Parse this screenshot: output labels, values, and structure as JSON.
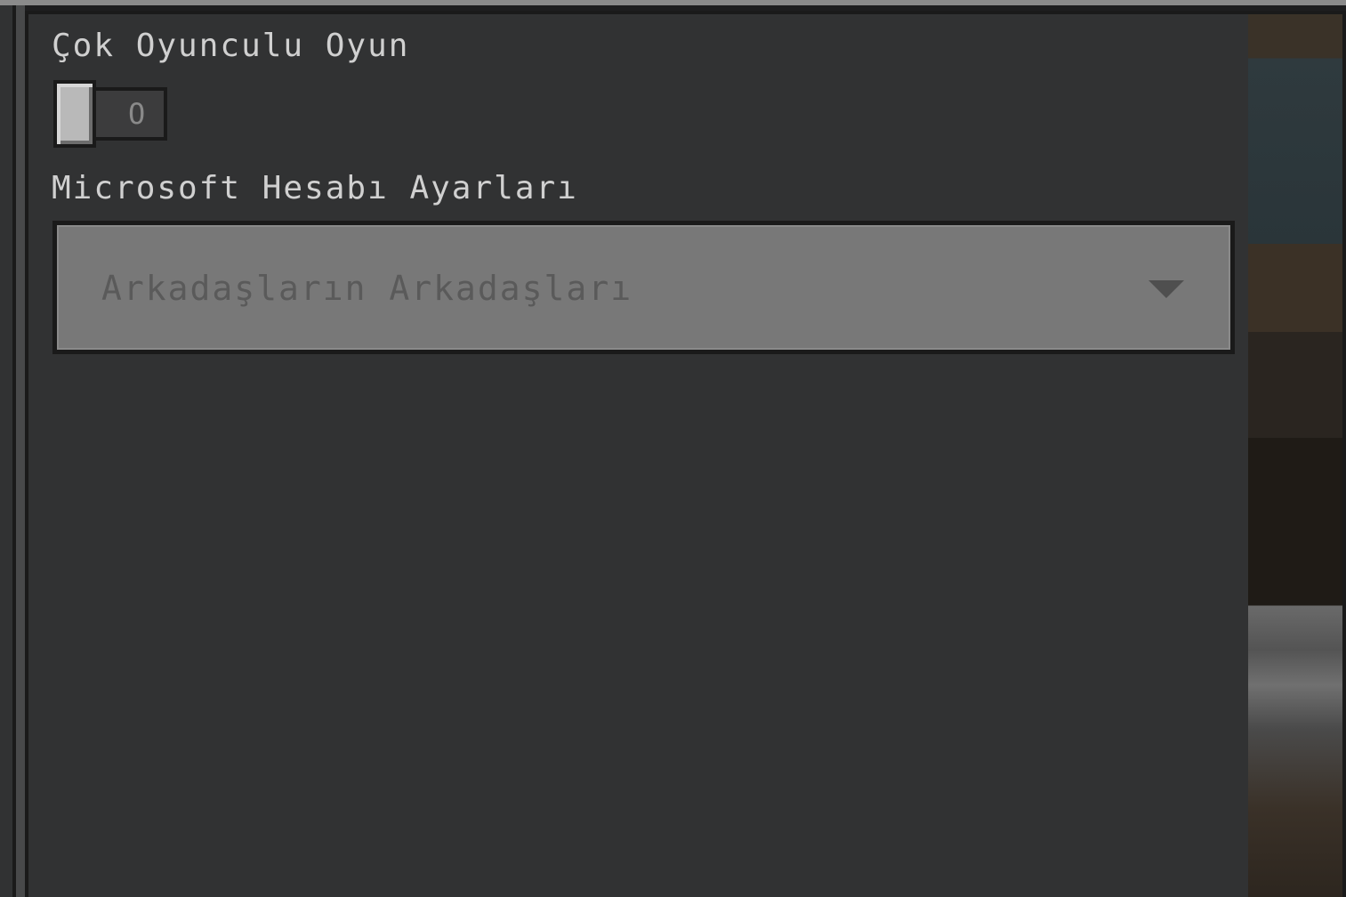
{
  "multiplayer": {
    "title": "Çok Oyunculu Oyun",
    "toggle_state": "off",
    "toggle_off_label": "O"
  },
  "account_settings": {
    "title": "Microsoft Hesabı Ayarları",
    "selected_value": "Arkadaşların Arkadaşları",
    "dropdown_icon": "chevron-down-icon"
  },
  "colors": {
    "panel_background": "#313233",
    "dropdown_background": "#787878",
    "title_text": "#d0d0d0",
    "disabled_text": "#5a5a5a"
  }
}
